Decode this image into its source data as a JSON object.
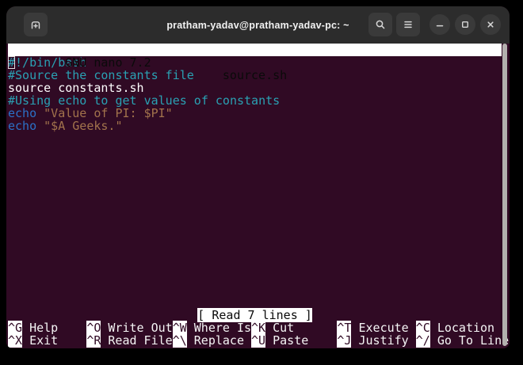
{
  "titlebar": {
    "title": "pratham-yadav@pratham-yadav-pc: ~",
    "icons": {
      "new_tab": "tab-new-icon",
      "search": "search-icon",
      "menu": "menu-icon",
      "minimize": "minimize-icon",
      "maximize": "maximize-icon",
      "close": "close-icon"
    }
  },
  "colors": {
    "desktop_bg": "#000000",
    "titlebar_bg": "#2C2C2C",
    "terminal_bg": "#300A24",
    "bar_bg": "#FFFFFF",
    "comment": "#2AA1B3",
    "keyword": "#2B71C7",
    "string": "#A2734C",
    "plain_text": "#FFFFFF",
    "scrollbar": "#B3B0AE"
  },
  "nano": {
    "version": "  GNU nano 7.2",
    "filename": "source.sh",
    "status": "[ Read 7 lines ]",
    "code_lines": [
      {
        "segments": [
          {
            "text": "#",
            "style": "comment",
            "cursor": true
          },
          {
            "text": "!/bin/bash",
            "style": "comment"
          }
        ]
      },
      {
        "segments": [
          {
            "text": "#Source the constants file",
            "style": "comment"
          }
        ]
      },
      {
        "segments": [
          {
            "text": "source constants.sh",
            "style": "plain"
          }
        ]
      },
      {
        "segments": [
          {
            "text": "#Using echo to get values of constants",
            "style": "comment"
          }
        ]
      },
      {
        "segments": [
          {
            "text": "echo",
            "style": "keyword"
          },
          {
            "text": " \"Value of PI: $PI\"",
            "style": "string"
          }
        ]
      },
      {
        "segments": [
          {
            "text": "echo",
            "style": "keyword"
          },
          {
            "text": " \"$A Geeks.\"",
            "style": "string"
          }
        ]
      }
    ],
    "shortcuts": {
      "row1": [
        {
          "key": "^G",
          "label": "Help"
        },
        {
          "key": "^O",
          "label": "Write Out"
        },
        {
          "key": "^W",
          "label": "Where Is"
        },
        {
          "key": "^K",
          "label": "Cut"
        },
        {
          "key": "^T",
          "label": "Execute"
        },
        {
          "key": "^C",
          "label": "Location"
        }
      ],
      "row2": [
        {
          "key": "^X",
          "label": "Exit"
        },
        {
          "key": "^R",
          "label": "Read File"
        },
        {
          "key": "^\\",
          "label": "Replace"
        },
        {
          "key": "^U",
          "label": "Paste"
        },
        {
          "key": "^J",
          "label": "Justify"
        },
        {
          "key": "^/",
          "label": "Go To Line"
        }
      ]
    }
  }
}
